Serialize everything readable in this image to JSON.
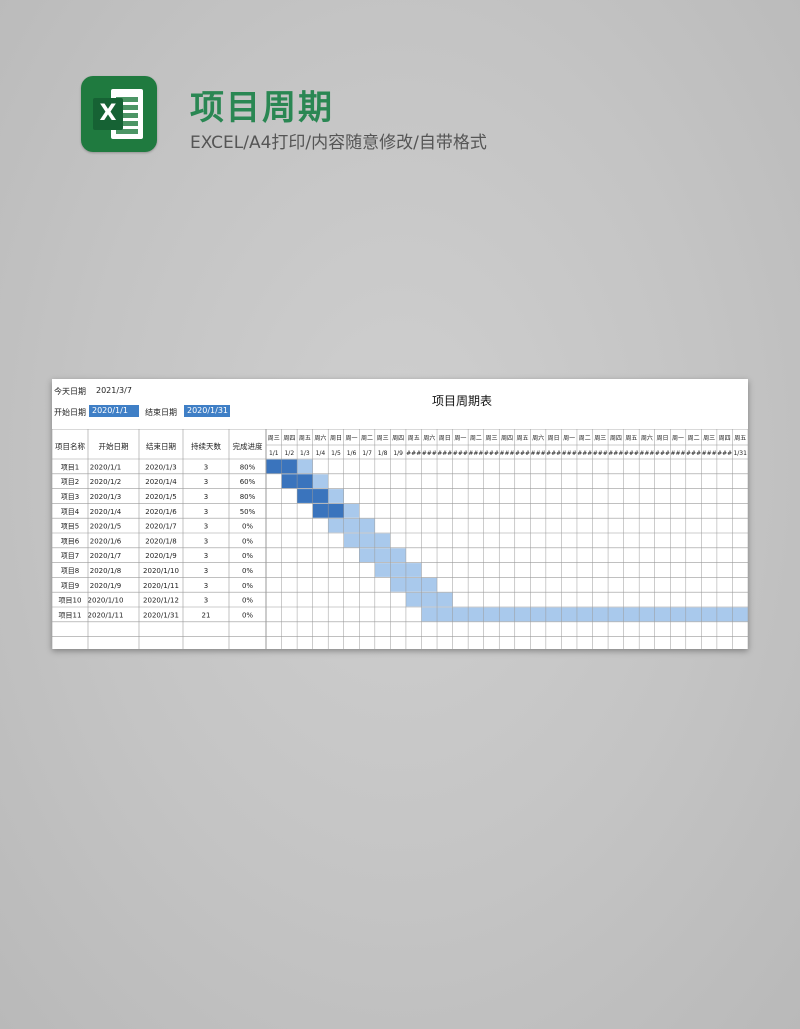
{
  "header": {
    "title": "项目周期",
    "subtitle": "EXCEL/A4打印/内容随意修改/自带格式"
  },
  "sheet": {
    "today_label": "今天日期",
    "today_value": "2021/3/7",
    "start_label": "开始日期",
    "start_value": "2020/1/1",
    "end_label": "结束日期",
    "end_value": "2020/1/31",
    "title": "项目周期表",
    "columns": [
      "项目名称",
      "开始日期",
      "结束日期",
      "持续天数",
      "完成进度"
    ],
    "weekdays": [
      "周三",
      "周四",
      "周五",
      "周六",
      "周日",
      "周一",
      "周二",
      "周三",
      "周四",
      "周五",
      "周六",
      "周日",
      "周一",
      "周二",
      "周三",
      "周四",
      "周五",
      "周六",
      "周日",
      "周一",
      "周二",
      "周三",
      "周四",
      "周五",
      "周六",
      "周日",
      "周一",
      "周二",
      "周三",
      "周四",
      "周五"
    ],
    "dates": [
      "1/1",
      "1/2",
      "1/3",
      "1/4",
      "1/5",
      "1/6",
      "1/7",
      "1/8",
      "1/9",
      "###",
      "###",
      "###",
      "###",
      "###",
      "###",
      "###",
      "###",
      "###",
      "###",
      "###",
      "###",
      "###",
      "###",
      "###",
      "###",
      "###",
      "###",
      "###",
      "###",
      "###",
      "1/31"
    ],
    "rows": [
      {
        "name": "项目1",
        "start": "2020/1/1",
        "end": "2020/1/3",
        "days": "3",
        "progress": "80%",
        "bar_start": 1,
        "bar_len": 3
      },
      {
        "name": "项目2",
        "start": "2020/1/2",
        "end": "2020/1/4",
        "days": "3",
        "progress": "60%",
        "bar_start": 2,
        "bar_len": 3
      },
      {
        "name": "项目3",
        "start": "2020/1/3",
        "end": "2020/1/5",
        "days": "3",
        "progress": "80%",
        "bar_start": 3,
        "bar_len": 3
      },
      {
        "name": "项目4",
        "start": "2020/1/4",
        "end": "2020/1/6",
        "days": "3",
        "progress": "50%",
        "bar_start": 4,
        "bar_len": 3
      },
      {
        "name": "项目5",
        "start": "2020/1/5",
        "end": "2020/1/7",
        "days": "3",
        "progress": "0%",
        "bar_start": 5,
        "bar_len": 3
      },
      {
        "name": "项目6",
        "start": "2020/1/6",
        "end": "2020/1/8",
        "days": "3",
        "progress": "0%",
        "bar_start": 6,
        "bar_len": 3
      },
      {
        "name": "项目7",
        "start": "2020/1/7",
        "end": "2020/1/9",
        "days": "3",
        "progress": "0%",
        "bar_start": 7,
        "bar_len": 3
      },
      {
        "name": "项目8",
        "start": "2020/1/8",
        "end": "2020/1/10",
        "days": "3",
        "progress": "0%",
        "bar_start": 8,
        "bar_len": 3
      },
      {
        "name": "项目9",
        "start": "2020/1/9",
        "end": "2020/1/11",
        "days": "3",
        "progress": "0%",
        "bar_start": 9,
        "bar_len": 3
      },
      {
        "name": "项目10",
        "start": "2020/1/10",
        "end": "2020/1/12",
        "days": "3",
        "progress": "0%",
        "bar_start": 10,
        "bar_len": 3
      },
      {
        "name": "项目11",
        "start": "2020/1/11",
        "end": "2020/1/31",
        "days": "21",
        "progress": "0%",
        "bar_start": 11,
        "bar_len": 21
      }
    ],
    "empty_rows": 2,
    "colors": {
      "selected": "#3f7fc6",
      "bar_done": "#3a74bd",
      "bar_todo": "#a9c9ec",
      "grid": "#9a9a9a"
    }
  },
  "icons": {
    "logo": "excel-logo-icon"
  }
}
